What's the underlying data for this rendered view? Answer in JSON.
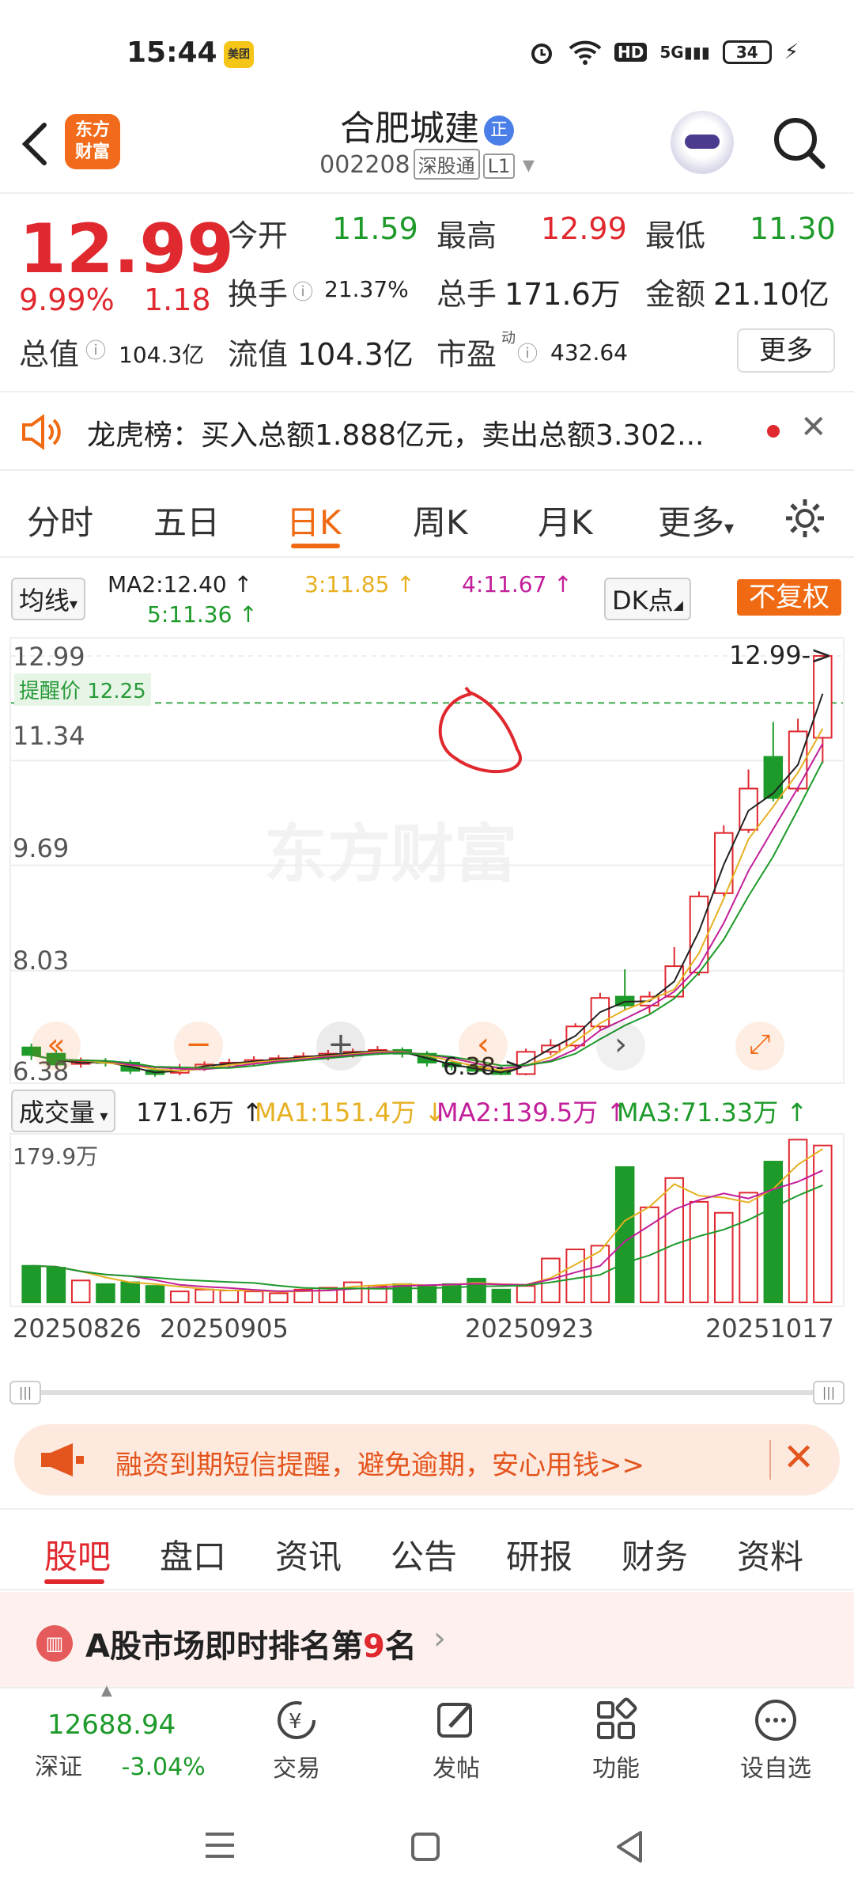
{
  "status_bar": {
    "time": "15:44",
    "app_badge": "美团",
    "network": "5G",
    "hd": "HD",
    "battery": "34"
  },
  "header": {
    "logo_text_1": "东方",
    "logo_text_2": "财富",
    "stock_name": "合肥城建",
    "badge": "正",
    "code": "002208",
    "tag1": "深股通",
    "tag2": "L1"
  },
  "quote": {
    "price": "12.99",
    "change_pct": "9.99%",
    "change": "1.18",
    "open_label": "今开",
    "open": "11.59",
    "high_label": "最高",
    "high": "12.99",
    "low_label": "最低",
    "low": "11.30",
    "turnover_label": "换手",
    "turnover": "21.37%",
    "volume_label": "总手",
    "volume": "171.6万",
    "amount_label": "金额",
    "amount": "21.10亿",
    "mktcap_label": "总值",
    "mktcap": "104.3亿",
    "float_label": "流值",
    "float_cap": "104.3亿",
    "pe_label": "市盈",
    "pe_sup": "动",
    "pe": "432.64",
    "more": "更多"
  },
  "dragon_tiger": {
    "text": "龙虎榜：买入总额1.888亿元，卖出总额3.302..."
  },
  "period_tabs": [
    "分时",
    "五日",
    "日K",
    "周K",
    "月K",
    "更多"
  ],
  "ma_row": {
    "select": "均线",
    "ma2": "MA2:12.40",
    "ma3": "3:11.85",
    "ma4": "4:11.67",
    "ma5": "5:11.36",
    "dk": "DK点",
    "fq": "不复权"
  },
  "chart_data": {
    "type": "candlestick",
    "y_ticks": [
      "12.99",
      "11.34",
      "9.69",
      "8.03",
      "6.38"
    ],
    "ylim": [
      6.38,
      12.99
    ],
    "alert_label": "提醒价 12.25",
    "alert_price": 12.25,
    "max_label": "12.99->",
    "min_label": "6.38->",
    "watermark": "东方财富",
    "candles": [
      {
        "o": 6.82,
        "c": 6.7,
        "h": 6.88,
        "l": 6.62
      },
      {
        "o": 6.72,
        "c": 6.55,
        "h": 6.78,
        "l": 6.5
      },
      {
        "o": 6.56,
        "c": 6.6,
        "h": 6.66,
        "l": 6.5
      },
      {
        "o": 6.6,
        "c": 6.58,
        "h": 6.65,
        "l": 6.52
      },
      {
        "o": 6.58,
        "c": 6.45,
        "h": 6.62,
        "l": 6.4
      },
      {
        "o": 6.46,
        "c": 6.4,
        "h": 6.52,
        "l": 6.36
      },
      {
        "o": 6.42,
        "c": 6.5,
        "h": 6.56,
        "l": 6.38
      },
      {
        "o": 6.5,
        "c": 6.55,
        "h": 6.6,
        "l": 6.45
      },
      {
        "o": 6.55,
        "c": 6.58,
        "h": 6.64,
        "l": 6.5
      },
      {
        "o": 6.58,
        "c": 6.62,
        "h": 6.68,
        "l": 6.52
      },
      {
        "o": 6.62,
        "c": 6.65,
        "h": 6.7,
        "l": 6.58
      },
      {
        "o": 6.64,
        "c": 6.68,
        "h": 6.74,
        "l": 6.6
      },
      {
        "o": 6.68,
        "c": 6.72,
        "h": 6.78,
        "l": 6.62
      },
      {
        "o": 6.72,
        "c": 6.75,
        "h": 6.8,
        "l": 6.66
      },
      {
        "o": 6.75,
        "c": 6.78,
        "h": 6.84,
        "l": 6.7
      },
      {
        "o": 6.78,
        "c": 6.72,
        "h": 6.82,
        "l": 6.66
      },
      {
        "o": 6.72,
        "c": 6.58,
        "h": 6.76,
        "l": 6.52
      },
      {
        "o": 6.58,
        "c": 6.52,
        "h": 6.62,
        "l": 6.46
      },
      {
        "o": 6.52,
        "c": 6.45,
        "h": 6.56,
        "l": 6.4
      },
      {
        "o": 6.45,
        "c": 6.4,
        "h": 6.5,
        "l": 6.38
      },
      {
        "o": 6.4,
        "c": 6.75,
        "h": 6.8,
        "l": 6.38
      },
      {
        "o": 6.75,
        "c": 6.85,
        "h": 6.95,
        "l": 6.7
      },
      {
        "o": 6.85,
        "c": 7.15,
        "h": 7.2,
        "l": 6.8
      },
      {
        "o": 7.15,
        "c": 7.6,
        "h": 7.68,
        "l": 7.1
      },
      {
        "o": 7.62,
        "c": 7.48,
        "h": 8.05,
        "l": 7.4
      },
      {
        "o": 7.48,
        "c": 7.62,
        "h": 7.7,
        "l": 7.36
      },
      {
        "o": 7.62,
        "c": 8.1,
        "h": 8.4,
        "l": 7.6
      },
      {
        "o": 8.0,
        "c": 9.2,
        "h": 9.28,
        "l": 7.95
      },
      {
        "o": 9.25,
        "c": 10.2,
        "h": 10.32,
        "l": 9.2
      },
      {
        "o": 10.25,
        "c": 10.9,
        "h": 11.2,
        "l": 10.2
      },
      {
        "o": 11.4,
        "c": 10.75,
        "h": 11.95,
        "l": 10.7
      },
      {
        "o": 10.9,
        "c": 11.8,
        "h": 12.0,
        "l": 10.85
      },
      {
        "o": 11.7,
        "c": 12.99,
        "h": 12.99,
        "l": 11.3
      }
    ],
    "volume": {
      "label": "成交量",
      "current": "171.6万",
      "ma1": "MA1:151.4万",
      "ma2": "MA2:139.5万",
      "ma3": "MA3:71.33万",
      "max_label": "179.9万",
      "values": [
        40,
        38,
        24,
        20,
        22,
        18,
        12,
        14,
        13,
        12,
        10,
        14,
        16,
        22,
        18,
        20,
        18,
        20,
        26,
        14,
        18,
        48,
        58,
        62,
        148,
        104,
        136,
        110,
        98,
        120,
        154,
        178,
        171.6
      ]
    },
    "dates": [
      "20250826",
      "20250905",
      "20250923",
      "20251017"
    ]
  },
  "promo": {
    "text": "融资到期短信提醒，避免逾期，安心用钱>>"
  },
  "content_tabs": [
    "股吧",
    "盘口",
    "资讯",
    "公告",
    "研报",
    "财务",
    "资料"
  ],
  "rank": {
    "prefix": "A股市场即时排名第",
    "num": "9",
    "suffix": "名"
  },
  "bottom_nav": {
    "index_value": "12688.94",
    "index_name": "深证",
    "index_change": "-3.04%",
    "items": [
      "交易",
      "发帖",
      "功能",
      "设自选"
    ]
  }
}
